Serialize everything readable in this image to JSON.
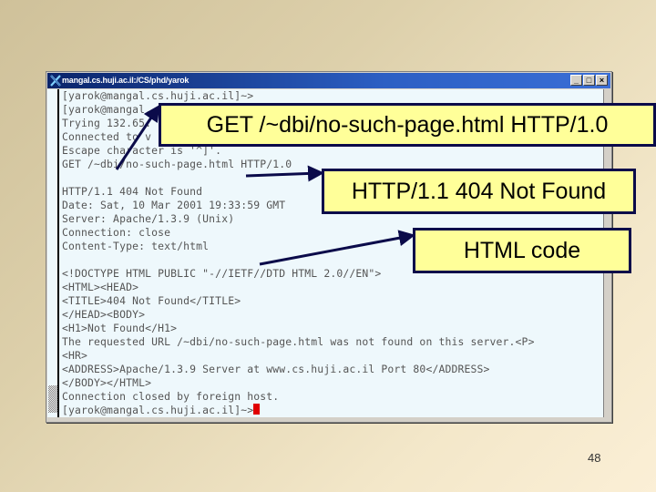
{
  "window": {
    "title": "mangal.cs.huji.ac.il:/CS/phd/yarok",
    "controls": {
      "minimize": "_",
      "maximize": "□",
      "close": "×"
    }
  },
  "terminal": {
    "lines": [
      "[yarok@mangal.cs.huji.ac.il]~>",
      "[yarok@mangal.",
      "Trying 132.65.",
      "Connected to v",
      "Escape character is '^]'.",
      "GET /~dbi/no-such-page.html HTTP/1.0",
      "",
      "HTTP/1.1 404 Not Found",
      "Date: Sat, 10 Mar 2001 19:33:59 GMT",
      "Server: Apache/1.3.9 (Unix)",
      "Connection: close",
      "Content-Type: text/html",
      "",
      "<!DOCTYPE HTML PUBLIC \"-//IETF//DTD HTML 2.0//EN\">",
      "<HTML><HEAD>",
      "<TITLE>404 Not Found</TITLE>",
      "</HEAD><BODY>",
      "<H1>Not Found</H1>",
      "The requested URL /~dbi/no-such-page.html was not found on this server.<P>",
      "<HR>",
      "<ADDRESS>Apache/1.3.9 Server at www.cs.huji.ac.il Port 80</ADDRESS>",
      "</BODY></HTML>",
      "Connection closed by foreign host.",
      "[yarok@mangal.cs.huji.ac.il]~>"
    ],
    "cursor_color": "#e00000"
  },
  "callouts": [
    {
      "label": "GET /~dbi/no-such-page.html HTTP/1.0"
    },
    {
      "label": "HTTP/1.1 404 Not Found"
    },
    {
      "label": "HTML code"
    }
  ],
  "colors": {
    "callout_fill": "#ffff99",
    "callout_border": "#0b0b4a",
    "arrow": "#0b0b4a",
    "terminal_bg": "#eef8fc"
  },
  "slide": {
    "page_number": "48"
  }
}
